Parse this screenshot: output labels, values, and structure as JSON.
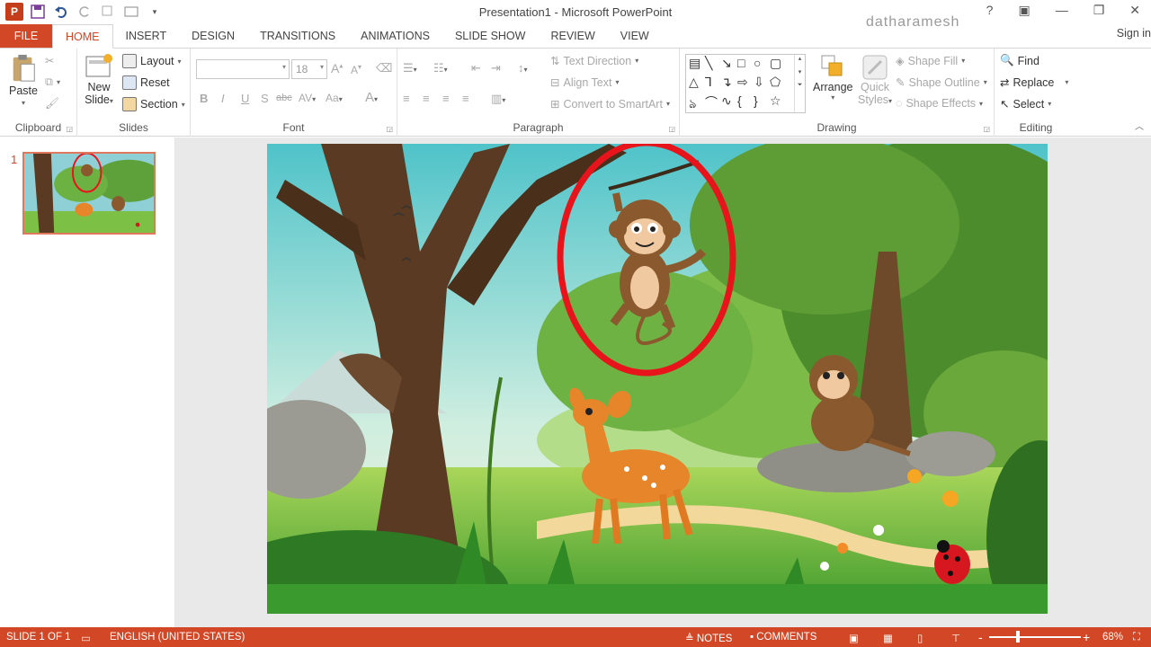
{
  "window": {
    "title": "Presentation1 - Microsoft PowerPoint",
    "watermark": "datharamesh",
    "help": "?",
    "sign_in": "Sign in"
  },
  "tabs": [
    "FILE",
    "HOME",
    "INSERT",
    "DESIGN",
    "TRANSITIONS",
    "ANIMATIONS",
    "SLIDE SHOW",
    "REVIEW",
    "VIEW"
  ],
  "active_tab": "HOME",
  "ribbon": {
    "clipboard": {
      "label": "Clipboard",
      "paste": "Paste"
    },
    "slides": {
      "label": "Slides",
      "new_slide": "New",
      "new_slide2": "Slide",
      "layout": "Layout",
      "reset": "Reset",
      "section": "Section"
    },
    "font": {
      "label": "Font",
      "size": "18",
      "bold": "B",
      "italic": "I",
      "underline": "U",
      "shadow": "S",
      "strike": "abc",
      "spacing": "AV",
      "case": "Aa",
      "color": "A",
      "grow": "A",
      "shrink": "A"
    },
    "paragraph": {
      "label": "Paragraph",
      "text_direction": "Text Direction",
      "align_text": "Align Text",
      "convert": "Convert to SmartArt"
    },
    "drawing": {
      "label": "Drawing",
      "arrange": "Arrange",
      "quick_styles": "Quick",
      "quick_styles2": "Styles",
      "shape_fill": "Shape Fill",
      "shape_outline": "Shape Outline",
      "shape_effects": "Shape Effects"
    },
    "editing": {
      "label": "Editing",
      "find": "Find",
      "replace": "Replace",
      "select": "Select"
    }
  },
  "thumbnail": {
    "number": "1"
  },
  "status": {
    "slide": "SLIDE 1 OF 1",
    "language": "ENGLISH (UNITED STATES)",
    "notes": "NOTES",
    "comments": "COMMENTS",
    "zoom": "68%",
    "zoom_minus": "-",
    "zoom_plus": "+"
  },
  "colors": {
    "accent": "#d24726",
    "highlight_ring": "#e8141c"
  }
}
